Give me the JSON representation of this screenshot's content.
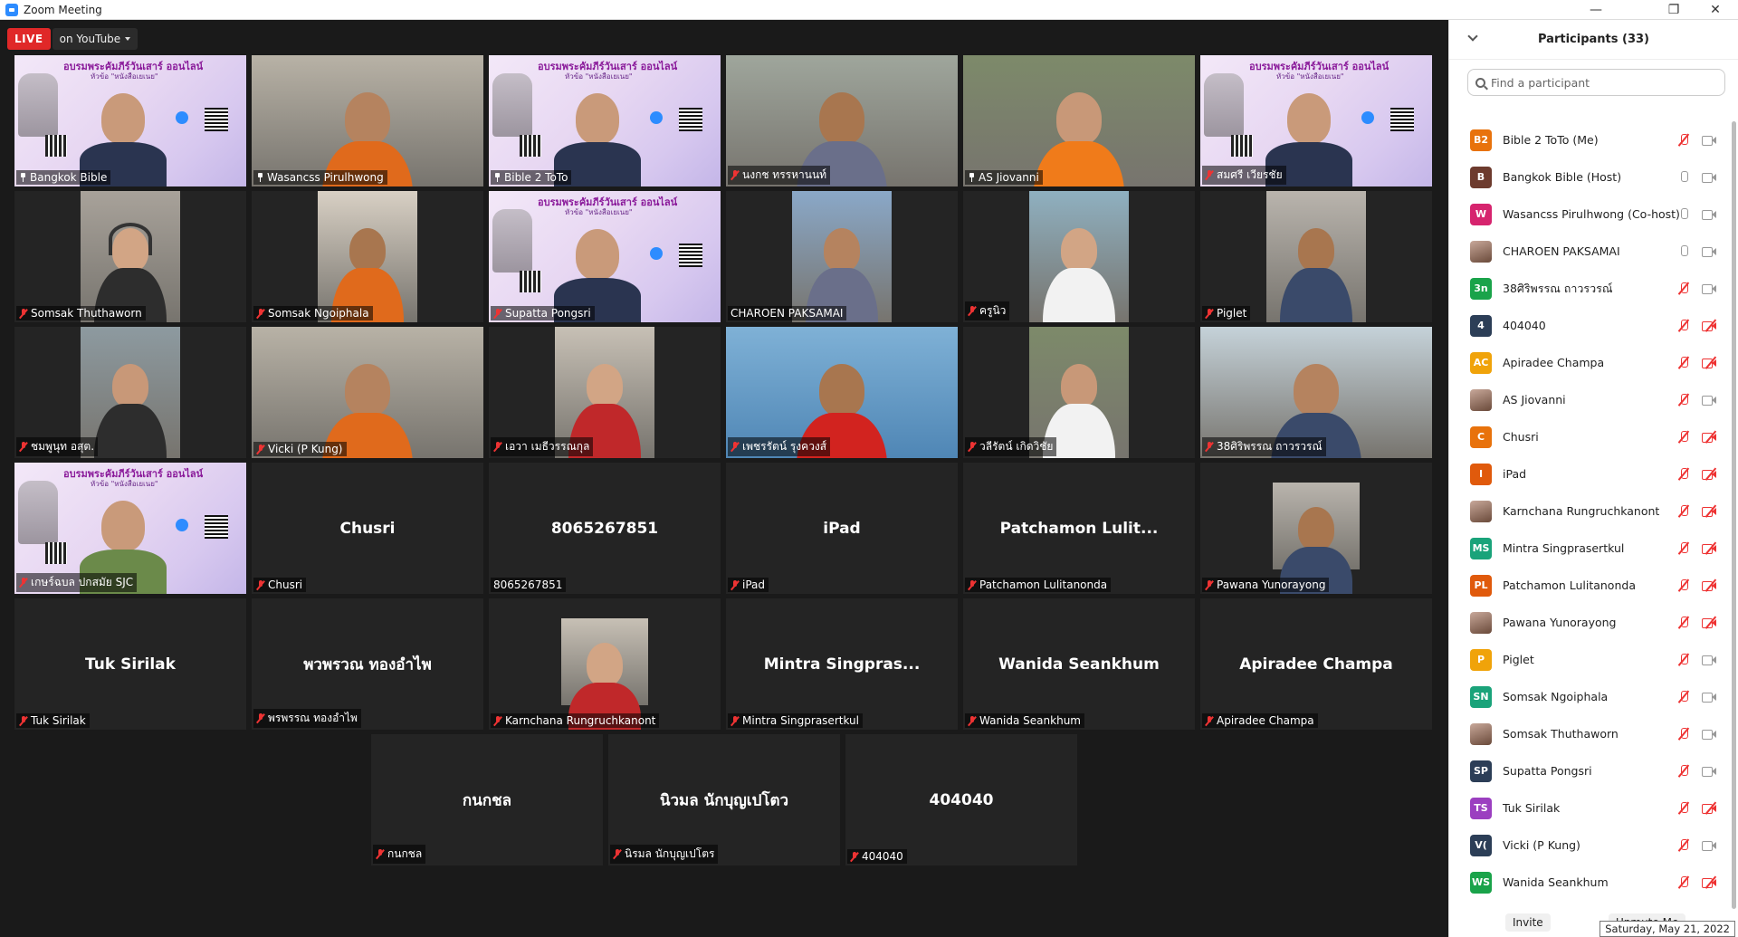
{
  "window": {
    "title": "Zoom Meeting",
    "minimize": "—",
    "restore": "❐",
    "close": "✕"
  },
  "live": {
    "badge": "LIVE",
    "destination": "on YouTube"
  },
  "tiles": [
    {
      "label": "Bangkok Bible",
      "big": ""
    },
    {
      "label": "Wasancss Pirulhwong",
      "big": ""
    },
    {
      "label": "Bible 2 ToTo",
      "big": ""
    },
    {
      "label": "นงกช ทรรหานนท์",
      "big": ""
    },
    {
      "label": "AS Jiovanni",
      "big": ""
    },
    {
      "label": "สมศรี เวียรชัย",
      "big": ""
    },
    {
      "label": "Somsak Thuthaworn",
      "big": ""
    },
    {
      "label": "Somsak Ngoiphala",
      "big": ""
    },
    {
      "label": "Supatta Pongsri",
      "big": ""
    },
    {
      "label": "CHAROEN PAKSAMAI",
      "big": ""
    },
    {
      "label": "ครูนิว",
      "big": ""
    },
    {
      "label": "Piglet",
      "big": ""
    },
    {
      "label": "ชมพูนุท อสุต.",
      "big": ""
    },
    {
      "label": "Vicki (P Kung)",
      "big": ""
    },
    {
      "label": "เอวา เมธีวรรณกุล",
      "big": ""
    },
    {
      "label": "เพชรรัตน์ รุงควงส์",
      "big": ""
    },
    {
      "label": "วลีรัตน์ เกิดวิชัย",
      "big": ""
    },
    {
      "label": "38ศิริพรรณ ถาวรวรณ์",
      "big": ""
    },
    {
      "label": "เกษร์ฉบล ปกสมัย SJC",
      "big": ""
    },
    {
      "label": "Chusri",
      "big": "Chusri"
    },
    {
      "label": "8065267851",
      "big": "8065267851"
    },
    {
      "label": "iPad",
      "big": "iPad"
    },
    {
      "label": "Patchamon Lulitanonda",
      "big": "Patchamon  Lulit..."
    },
    {
      "label": "Pawana Yunorayong",
      "big": ""
    },
    {
      "label": "Tuk Sirilak",
      "big": "Tuk Sirilak"
    },
    {
      "label": "พรพรรณ ทองอำไพ",
      "big": "พวพรวณ ทองอำไพ"
    },
    {
      "label": "Karnchana Rungruchkanont",
      "big": ""
    },
    {
      "label": "Mintra Singprasertkul",
      "big": "Mintra  Singpras..."
    },
    {
      "label": "Wanida Seankhum",
      "big": "Wanida Seankhum"
    },
    {
      "label": "Apiradee Champa",
      "big": "Apiradee Champa"
    },
    {
      "label": "กนกชล",
      "big": "กนกชล"
    },
    {
      "label": "นิรมล นักบุญเปโตร",
      "big": "นิวมล นักบุญเปโตว"
    },
    {
      "label": "404040",
      "big": "404040"
    }
  ],
  "poster": {
    "title": "อบรมพระคัมภีร์วันเสาร์ ออนไลน์",
    "subtitle": "หัวข้อ \"หนังสือเยเนย\""
  },
  "panel": {
    "title": "Participants (33)",
    "search_placeholder": "Find a participant",
    "invite": "Invite",
    "unmute": "Unmute Me",
    "date_tooltip": "Saturday, May 21, 2022",
    "participants": [
      {
        "initials": "B2",
        "color": "#e8720c",
        "name": "Bible 2 ToTo (Me)",
        "mic": "off",
        "cam": "on"
      },
      {
        "initials": "B",
        "color": "#6d3b2e",
        "name": "Bangkok Bible (Host)",
        "mic": "on",
        "cam": "on"
      },
      {
        "initials": "W",
        "color": "#d6246e",
        "name": "Wasancss Pirulhwong (Co-host)",
        "mic": "on",
        "cam": "on"
      },
      {
        "initials": "",
        "color": "photo",
        "name": "CHAROEN PAKSAMAI",
        "mic": "on",
        "cam": "on"
      },
      {
        "initials": "3n",
        "color": "#1aa34a",
        "name": "38ศิริพรรณ ถาวรวรณ์",
        "mic": "off",
        "cam": "on"
      },
      {
        "initials": "4",
        "color": "#2c3e57",
        "name": "404040",
        "mic": "off",
        "cam": "off"
      },
      {
        "initials": "AC",
        "color": "#f0a30a",
        "name": "Apiradee Champa",
        "mic": "off",
        "cam": "off"
      },
      {
        "initials": "",
        "color": "photo",
        "name": "AS Jiovanni",
        "mic": "off",
        "cam": "on"
      },
      {
        "initials": "C",
        "color": "#e8720c",
        "name": "Chusri",
        "mic": "off",
        "cam": "off"
      },
      {
        "initials": "I",
        "color": "#e05a0c",
        "name": "iPad",
        "mic": "off",
        "cam": "off"
      },
      {
        "initials": "",
        "color": "photo",
        "name": "Karnchana Rungruchkanont",
        "mic": "off",
        "cam": "off"
      },
      {
        "initials": "MS",
        "color": "#1aa37a",
        "name": "Mintra Singprasertkul",
        "mic": "off",
        "cam": "off"
      },
      {
        "initials": "PL",
        "color": "#e05a0c",
        "name": "Patchamon Lulitanonda",
        "mic": "off",
        "cam": "off"
      },
      {
        "initials": "",
        "color": "photo",
        "name": "Pawana Yunorayong",
        "mic": "off",
        "cam": "off"
      },
      {
        "initials": "P",
        "color": "#f0a30a",
        "name": "Piglet",
        "mic": "off",
        "cam": "on"
      },
      {
        "initials": "SN",
        "color": "#1aa37a",
        "name": "Somsak Ngoiphala",
        "mic": "off",
        "cam": "on"
      },
      {
        "initials": "",
        "color": "photo",
        "name": "Somsak Thuthaworn",
        "mic": "off",
        "cam": "on"
      },
      {
        "initials": "SP",
        "color": "#2c3e57",
        "name": "Supatta Pongsri",
        "mic": "off",
        "cam": "on"
      },
      {
        "initials": "TS",
        "color": "#9b3fc0",
        "name": "Tuk Sirilak",
        "mic": "off",
        "cam": "off"
      },
      {
        "initials": "V(",
        "color": "#2c3e57",
        "name": "Vicki (P Kung)",
        "mic": "off",
        "cam": "on"
      },
      {
        "initials": "WS",
        "color": "#1aa34a",
        "name": "Wanida Seankhum",
        "mic": "off",
        "cam": "off"
      }
    ]
  }
}
